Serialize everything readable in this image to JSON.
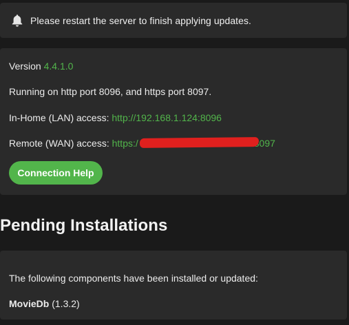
{
  "notification": {
    "icon": "bell-icon",
    "message": "Please restart the server to finish applying updates."
  },
  "server_info": {
    "version_label": "Version ",
    "version_value": "4.4.1.0",
    "running_text": "Running on http port 8096, and https port 8097.",
    "lan_label": "In-Home (LAN) access: ",
    "lan_url": "http://192.168.1.124:8096",
    "wan_label": "Remote (WAN) access: ",
    "wan_url_prefix": "https:/",
    "wan_url_suffix": "8097",
    "connection_help_label": "Connection Help"
  },
  "pending_installations": {
    "title": "Pending Installations",
    "description": "The following components have been installed or updated:",
    "components": [
      {
        "name": "MovieDb",
        "version": " (1.3.2)"
      }
    ]
  },
  "colors": {
    "accent": "#52b54b",
    "card_bg": "#2a2a2a",
    "page_bg": "#1a1a1a",
    "redaction": "#e0201e"
  }
}
